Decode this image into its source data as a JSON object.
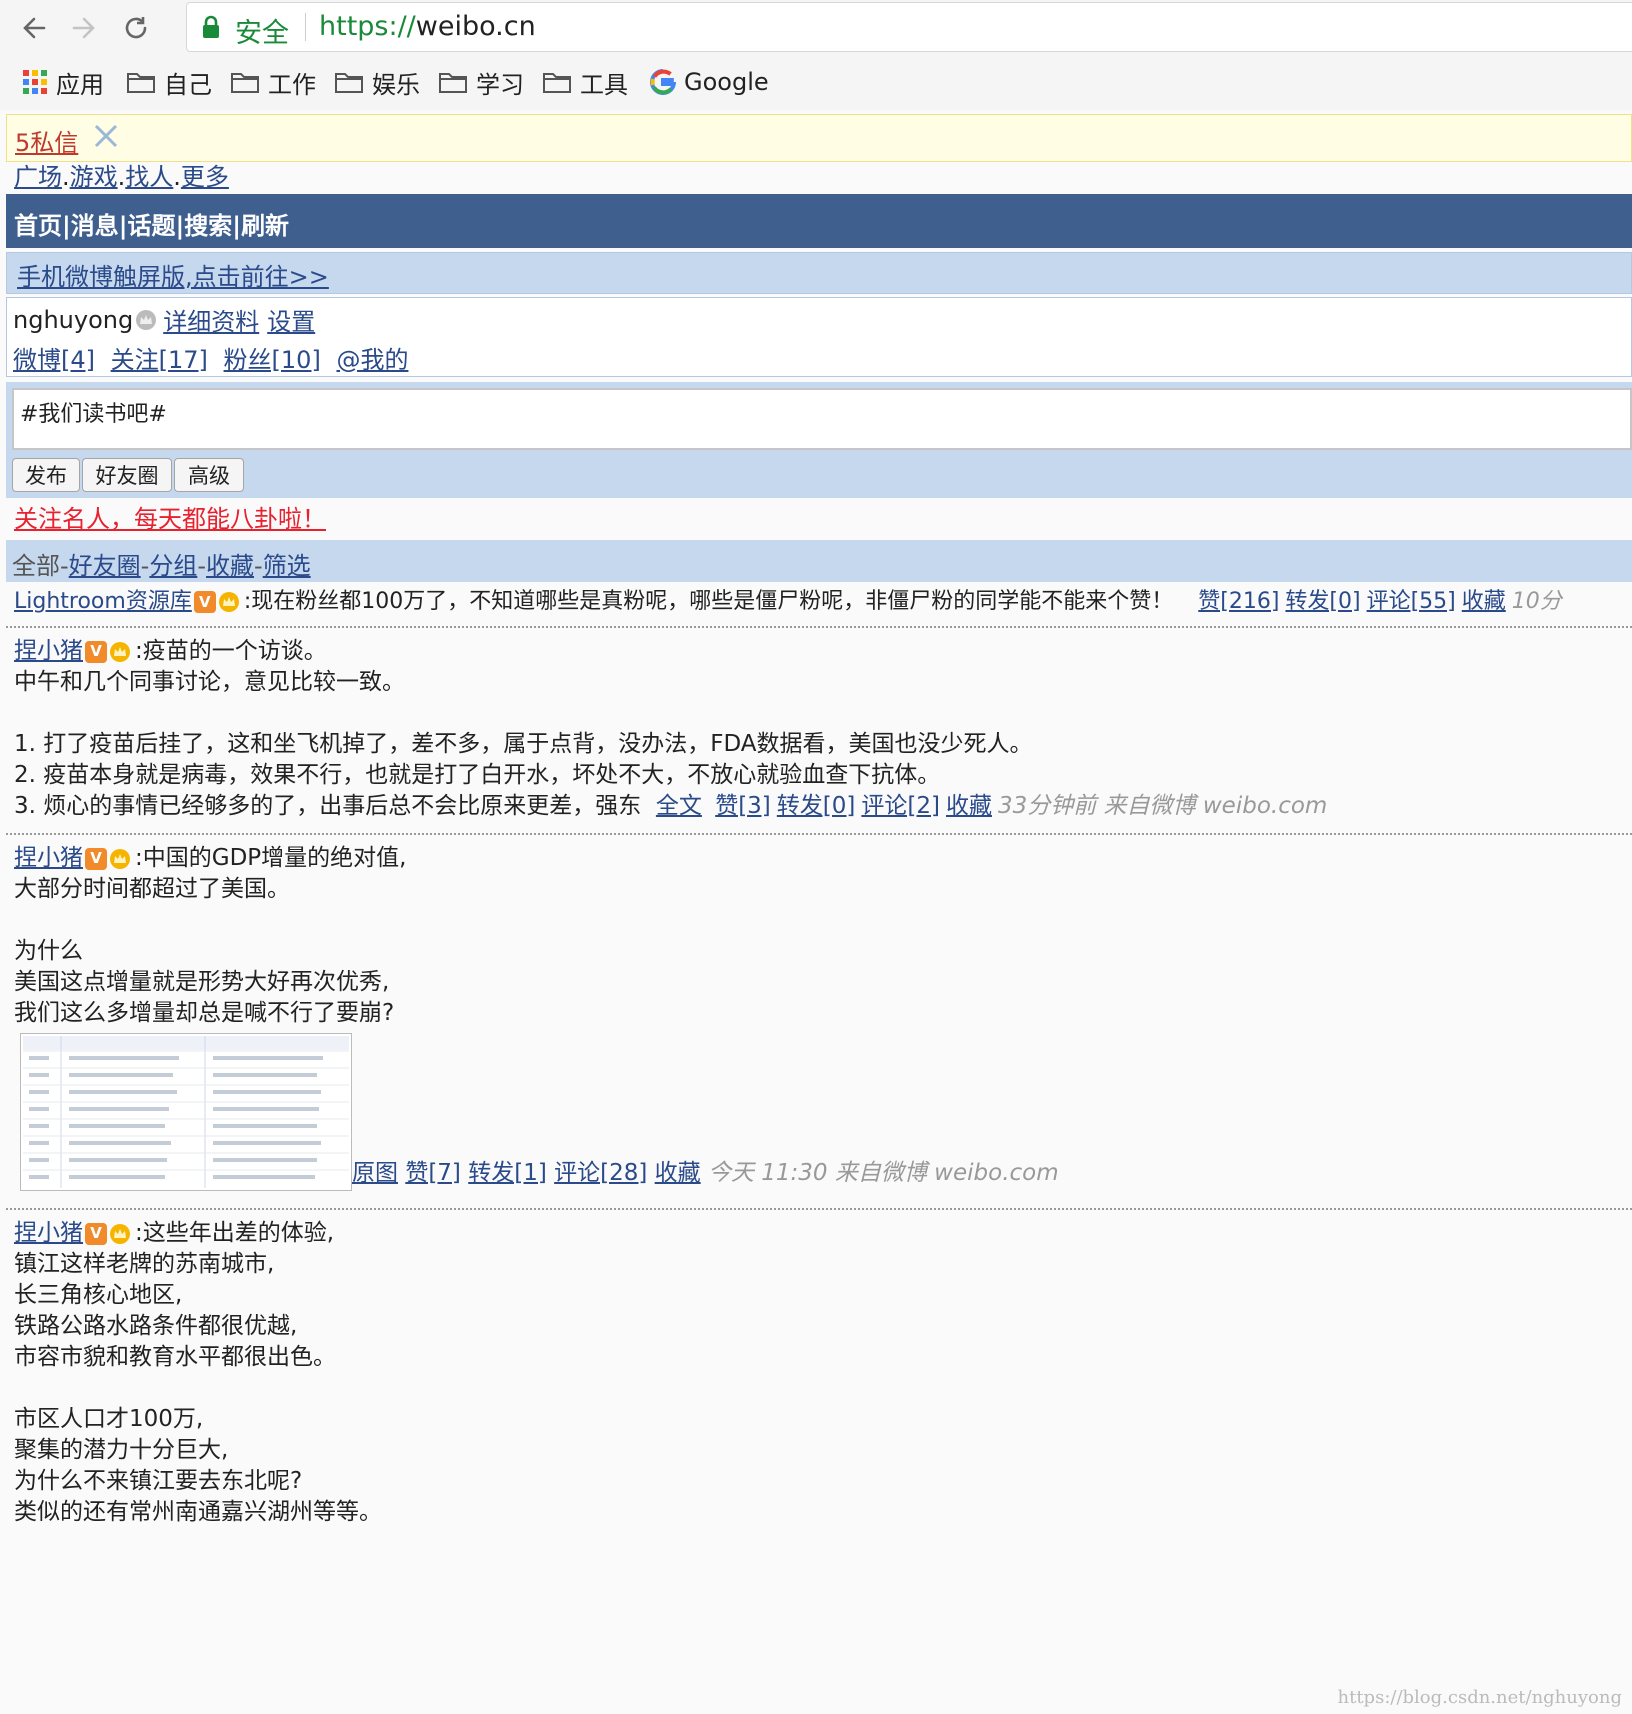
{
  "browser": {
    "secure_label": "安全",
    "url_scheme": "https://",
    "url_host": "weibo.cn",
    "bookmarks": [
      {
        "label": "应用",
        "icon": "apps-grid-icon"
      },
      {
        "label": "自己",
        "icon": "folder-icon"
      },
      {
        "label": "工作",
        "icon": "folder-icon"
      },
      {
        "label": "娱乐",
        "icon": "folder-icon"
      },
      {
        "label": "学习",
        "icon": "folder-icon"
      },
      {
        "label": "工具",
        "icon": "folder-icon"
      },
      {
        "label": "Google",
        "icon": "google-icon"
      }
    ]
  },
  "message_bar": {
    "label": "5私信"
  },
  "sub_nav": {
    "items": [
      "广场",
      "游戏",
      "找人",
      "更多"
    ],
    "sep": "."
  },
  "top_nav": {
    "items": [
      "首页",
      "消息",
      "话题",
      "搜索",
      "刷新"
    ],
    "sep": "|"
  },
  "touch_link": "手机微博触屏版,点击前往>>",
  "profile": {
    "username": "nghuyong",
    "detail_link": "详细资料",
    "settings_link": "设置",
    "stats": [
      "微博[4]",
      "关注[17]",
      "粉丝[10]",
      "@我的"
    ]
  },
  "compose": {
    "value": "#我们读书吧#",
    "buttons": [
      "发布",
      "好友圈",
      "高级"
    ]
  },
  "promo": "关注名人，每天都能八卦啦！",
  "filter": {
    "current": "全部",
    "links": [
      "好友圈",
      "分组",
      "收藏",
      "筛选"
    ],
    "sep": "-"
  },
  "posts": [
    {
      "author": "Lightroom资源库",
      "text": ":现在粉丝都100万了，不知道哪些是真粉呢，哪些是僵尸粉呢，非僵尸粉的同学能不能来个赞！",
      "actions": [
        "赞[216]",
        "转发[0]",
        "评论[55]",
        "收藏"
      ],
      "meta": "10分"
    },
    {
      "author": "捏小猪",
      "lines": [
        ":疫苗的一个访谈。",
        "中午和几个同事讨论，意见比较一致。",
        "",
        "1. 打了疫苗后挂了，这和坐飞机掉了，差不多，属于点背，没办法，FDA数据看，美国也没少死人。",
        "2. 疫苗本身就是病毒，效果不行，也就是打了白开水，坏处不大，不放心就验血查下抗体。"
      ],
      "last_line": "3. 烦心的事情已经够多的了，出事后总不会比原来更差，强东",
      "actions": [
        "全文",
        "赞[3]",
        "转发[0]",
        "评论[2]",
        "收藏"
      ],
      "meta": "33分钟前 来自微博 weibo.com"
    },
    {
      "author": "捏小猪",
      "lines": [
        ":中国的GDP增量的绝对值,",
        "大部分时间都超过了美国。",
        "",
        "为什么",
        "美国这点增量就是形势大好再次优秀,",
        "我们这么多增量却总是喊不行了要崩?"
      ],
      "actions": [
        "原图",
        "赞[7]",
        "转发[1]",
        "评论[28]",
        "收藏"
      ],
      "meta": "今天 11:30 来自微博 weibo.com"
    },
    {
      "author": "捏小猪",
      "lines": [
        ":这些年出差的体验,",
        "镇江这样老牌的苏南城市,",
        "长三角核心地区,",
        "铁路公路水路条件都很优越,",
        "市容市貌和教育水平都很出色。",
        "",
        "市区人口才100万,",
        "聚集的潜力十分巨大,",
        "为什么不来镇江要去东北呢?",
        "类似的还有常州南通嘉兴湖州等等。"
      ]
    }
  ],
  "badge_v": "V",
  "watermark": "https://blog.csdn.net/nghuyong",
  "colors": {
    "nav_bg": "#3f5f8f",
    "bar_bg": "#c6d8ee",
    "link": "#2a4a8a",
    "promo": "#e8212f",
    "secure": "#1a8a3a"
  }
}
